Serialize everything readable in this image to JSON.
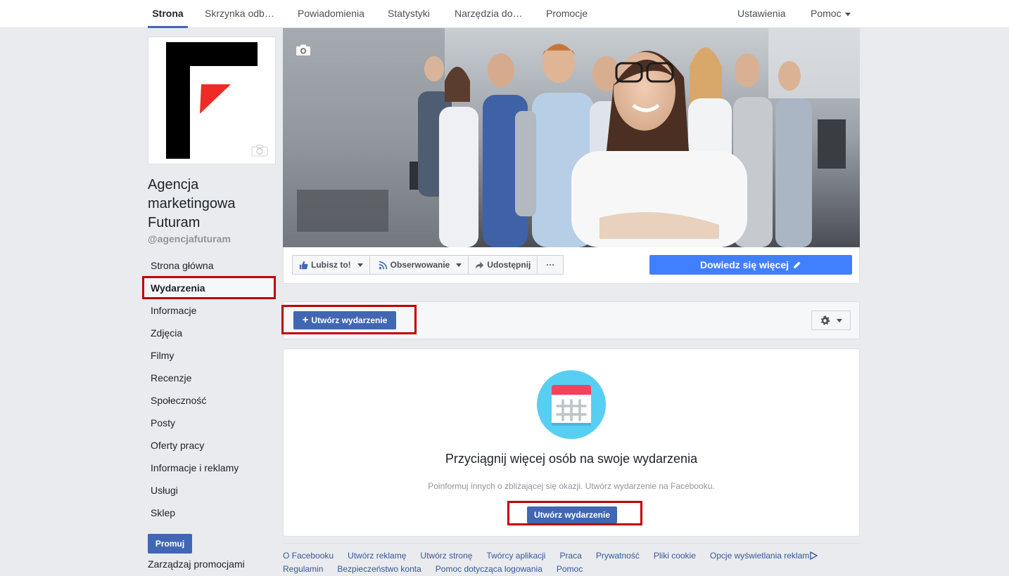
{
  "topnav": {
    "tabs": [
      "Strona",
      "Skrzynka odb…",
      "Powiadomienia",
      "Statystyki",
      "Narzędzia do…",
      "Promocje"
    ],
    "settings": "Ustawienia",
    "help": "Pomoc"
  },
  "page": {
    "name": "Agencja marketingowa Futuram",
    "handle": "@agencjafuturam"
  },
  "leftnav": {
    "items": [
      "Strona główna",
      "Wydarzenia",
      "Informacje",
      "Zdjęcia",
      "Filmy",
      "Recenzje",
      "Społeczność",
      "Posty",
      "Oferty pracy",
      "Informacje i reklamy",
      "Usługi",
      "Sklep"
    ],
    "active": "Wydarzenia",
    "promote": "Promuj",
    "manage_promotions": "Zarządzaj promocjami"
  },
  "actions": {
    "like": "Lubisz to!",
    "follow": "Obserwowanie",
    "share": "Udostępnij",
    "more": "···",
    "learn_more": "Dowiedz się więcej"
  },
  "events": {
    "create_button": "Utwórz wydarzenie",
    "empty_title": "Przyciągnij więcej osób na swoje wydarzenia",
    "empty_subtitle": "Poinformuj innych o zbliżającej się okazji. Utwórz wydarzenie na Facebooku.",
    "empty_button": "Utwórz wydarzenie"
  },
  "footer": {
    "row1": [
      "O Facebooku",
      "Utwórz reklamę",
      "Utwórz stronę",
      "Twórcy aplikacji",
      "Praca",
      "Prywatność",
      "Pliki cookie",
      "Opcje wyświetlania reklam"
    ],
    "row2": [
      "Regulamin",
      "Bezpieczeństwo konta",
      "Pomoc dotycząca logowania",
      "Pomoc"
    ]
  },
  "colors": {
    "brand_blue": "#4267b2",
    "cta_blue": "#4080ff",
    "highlight_red": "#c00000",
    "background": "#e9ebee",
    "calendar_circle": "#57cff2",
    "calendar_header": "#f3425f"
  }
}
